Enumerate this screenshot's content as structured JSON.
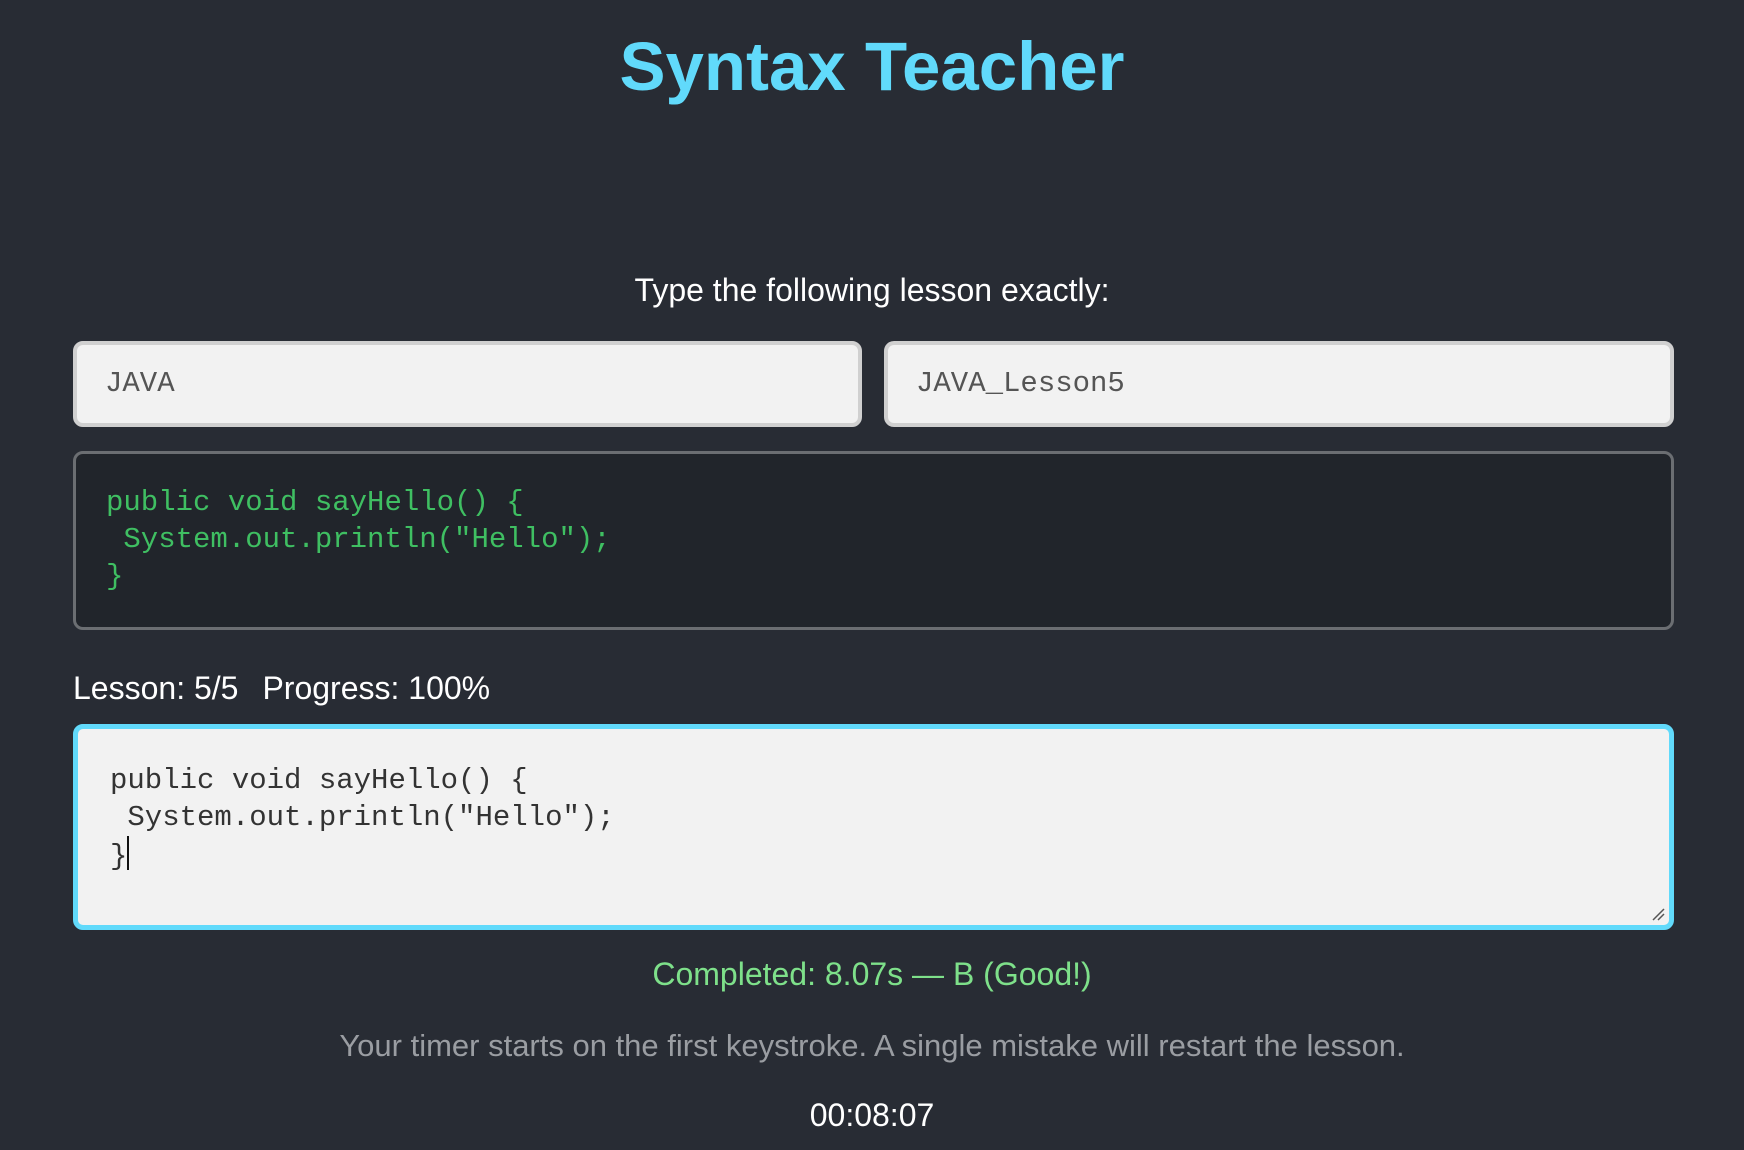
{
  "app": {
    "title": "Syntax Teacher",
    "instruction": "Type the following lesson exactly:"
  },
  "selectors": {
    "language": "JAVA",
    "lesson": "JAVA_Lesson5"
  },
  "lesson_code": "public void sayHello() {\n System.out.println(\"Hello\");\n}",
  "status": {
    "lesson": "Lesson: 5/5",
    "progress": "Progress: 100%",
    "progress_value": 100
  },
  "typed_input": "public void sayHello() {\n System.out.println(\"Hello\");\n}",
  "result": "Completed: 8.07s — B (Good!)",
  "hint": "Your timer starts on the first keystroke. A single mistake will restart the lesson.",
  "timer": "00:08:07",
  "colors": {
    "background": "#282c34",
    "accent": "#61dafb",
    "code_text": "#3fbf62",
    "success": "#7ee08a"
  }
}
